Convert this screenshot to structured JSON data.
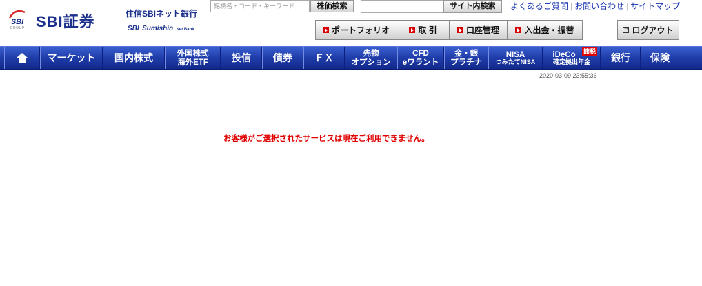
{
  "header": {
    "group_logo": {
      "text": "SBI",
      "sub": "GROUP"
    },
    "brand_name": "SBI証券",
    "bank_name_jp": "住信SBIネット銀行",
    "bank_name_en": {
      "sbi": "SBI",
      "sumishin": "Sumishin",
      "netbank": "Net Bank"
    }
  },
  "search": {
    "placeholder": "銘柄名・コード・キーワード",
    "stock_search_label": "株価検索",
    "site_search_label": "サイト内検索"
  },
  "utility_links": [
    "よくあるご質問",
    "お問い合わせ",
    "サイトマップ"
  ],
  "function_buttons": [
    "ポートフォリオ",
    "取 引",
    "口座管理",
    "入出金・振替"
  ],
  "logout_label": "ログアウト",
  "nav": {
    "items": [
      {
        "l1": "マーケット"
      },
      {
        "l1": "国内株式"
      },
      {
        "l1": "外国株式",
        "l2": "海外ETF"
      },
      {
        "l1": "投信"
      },
      {
        "l1": "債券"
      },
      {
        "l1": "ＦＸ"
      },
      {
        "l1": "先物",
        "l2": "オプション"
      },
      {
        "l1": "CFD",
        "l2": "eワラント"
      },
      {
        "l1": "金・銀",
        "l2": "プラチナ"
      },
      {
        "l1": "NISA",
        "l2": "つみたてNISA"
      },
      {
        "l1": "iDeCo",
        "l2": "確定拠出年金",
        "badge": "節税"
      },
      {
        "l1": "銀行"
      },
      {
        "l1": "保険"
      }
    ]
  },
  "timestamp": "2020-03-09 23:55:36",
  "message": "お客様がご選択されたサービスは現在ご利用できません。",
  "colors": {
    "nav_blue": "#1f3ca8",
    "alert_red": "#e00000",
    "brand_blue": "#1b2f8c"
  }
}
